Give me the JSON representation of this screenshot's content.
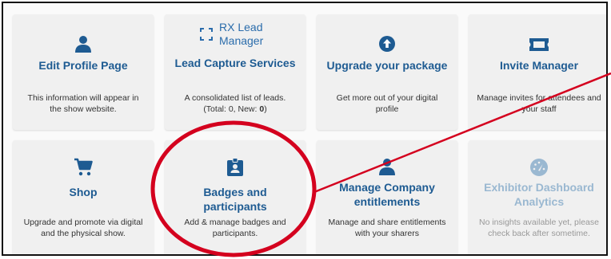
{
  "colors": {
    "accent": "#1e5b92",
    "icon_blue": "#2a6cab",
    "card_bg": "#f0f0f0",
    "annotation_red": "#d4001e"
  },
  "cards": [
    {
      "icon": "person-icon",
      "title": "Edit Profile Page",
      "desc": "This information will appear in the show website."
    },
    {
      "icon": "scan-frame-icon",
      "logo_text": "RX Lead Manager",
      "title": "Lead Capture Services",
      "desc_prefix": "A consolidated list of leads. (Total: 0, New:",
      "desc_value": "0",
      "desc_suffix": ")"
    },
    {
      "icon": "upload-circle-icon",
      "title": "Upgrade your package",
      "desc": "Get more out of your digital profile"
    },
    {
      "icon": "ticket-icon",
      "title": "Invite Manager",
      "desc": "Manage invites for attendees and your staff"
    },
    {
      "icon": "shopping-cart-icon",
      "title": "Shop",
      "desc": "Upgrade and promote via digital and the physical show."
    },
    {
      "icon": "badge-icon",
      "title": "Badges and participants",
      "desc": "Add & manage badges and participants."
    },
    {
      "icon": "person-icon",
      "title": "Manage Company entitlements",
      "desc": "Manage and share entitlements with your sharers"
    },
    {
      "icon": "speedometer-icon",
      "title": "Exhibitor Dashboard Analytics",
      "desc": "No insights available yet, please check back after sometime.",
      "disabled": true
    }
  ]
}
